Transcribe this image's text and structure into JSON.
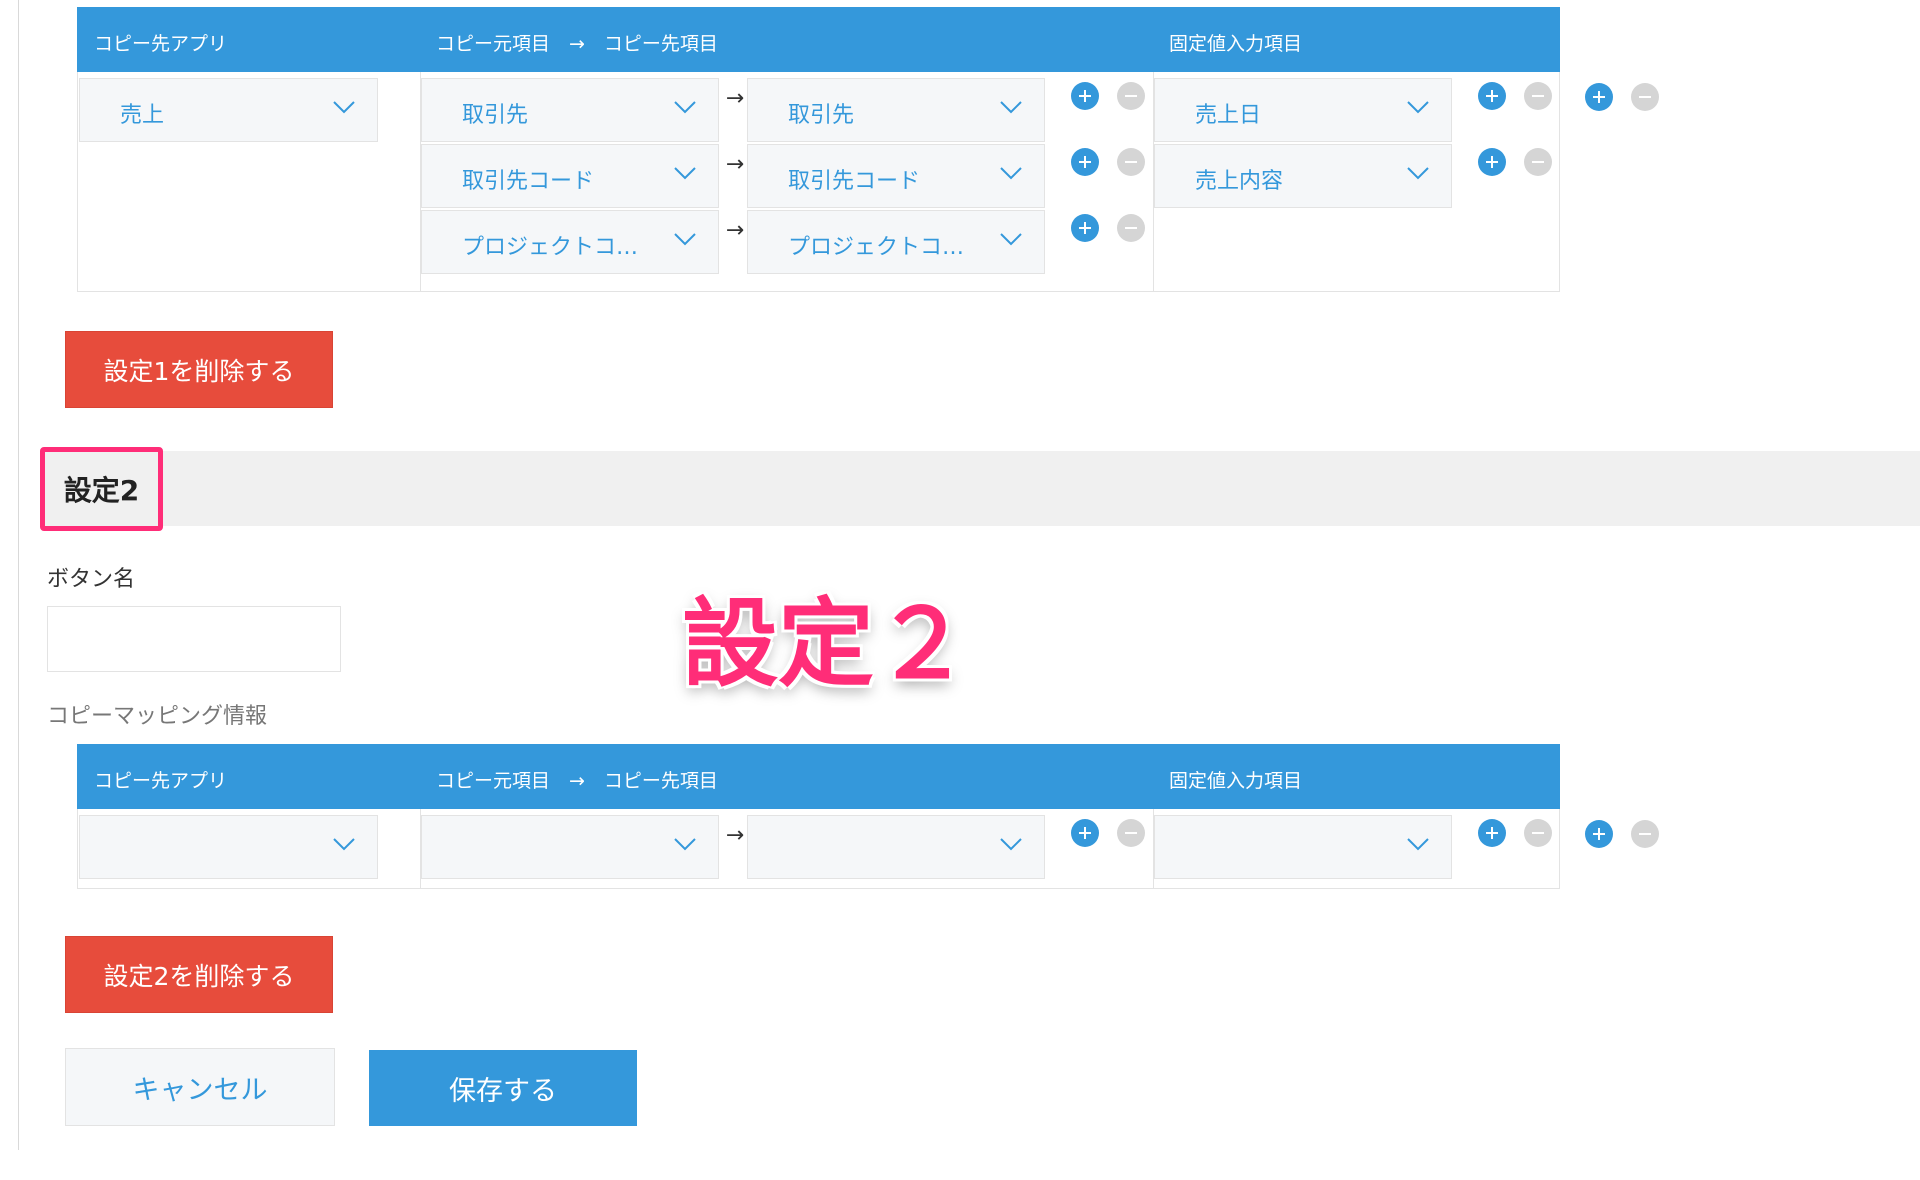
{
  "columns": {
    "dest_app": "コピー先アプリ",
    "source_dest_fields": "コピー元項目　→　コピー先項目",
    "fixed_fields": "固定値入力項目"
  },
  "setting1": {
    "dest_app": "売上",
    "mappings": [
      {
        "source": "取引先",
        "dest": "取引先"
      },
      {
        "source": "取引先コード",
        "dest": "取引先コード"
      },
      {
        "source": "プロジェクトコ…",
        "dest": "プロジェクトコ…"
      }
    ],
    "fixed_fields": [
      "売上日",
      "売上内容"
    ],
    "delete_label": "設定1を削除する"
  },
  "setting2": {
    "title": "設定2",
    "button_name_label": "ボタン名",
    "button_name_value": "",
    "mapping_label": "コピーマッピング情報",
    "dest_app": "",
    "mappings": [
      {
        "source": "",
        "dest": ""
      }
    ],
    "fixed_fields": [
      ""
    ],
    "delete_label": "設定2を削除する"
  },
  "annotation": "設定２",
  "arrow_symbol": "→",
  "footer": {
    "cancel_label": "キャンセル",
    "save_label": "保存する"
  },
  "colors": {
    "primary": "#3498db",
    "danger": "#e74c3c",
    "highlight": "#ff2d78",
    "disabled": "#d5d5d5"
  },
  "icons": {
    "chevron": "chevron-down-icon",
    "add": "plus-circle-icon",
    "remove": "minus-circle-icon"
  }
}
